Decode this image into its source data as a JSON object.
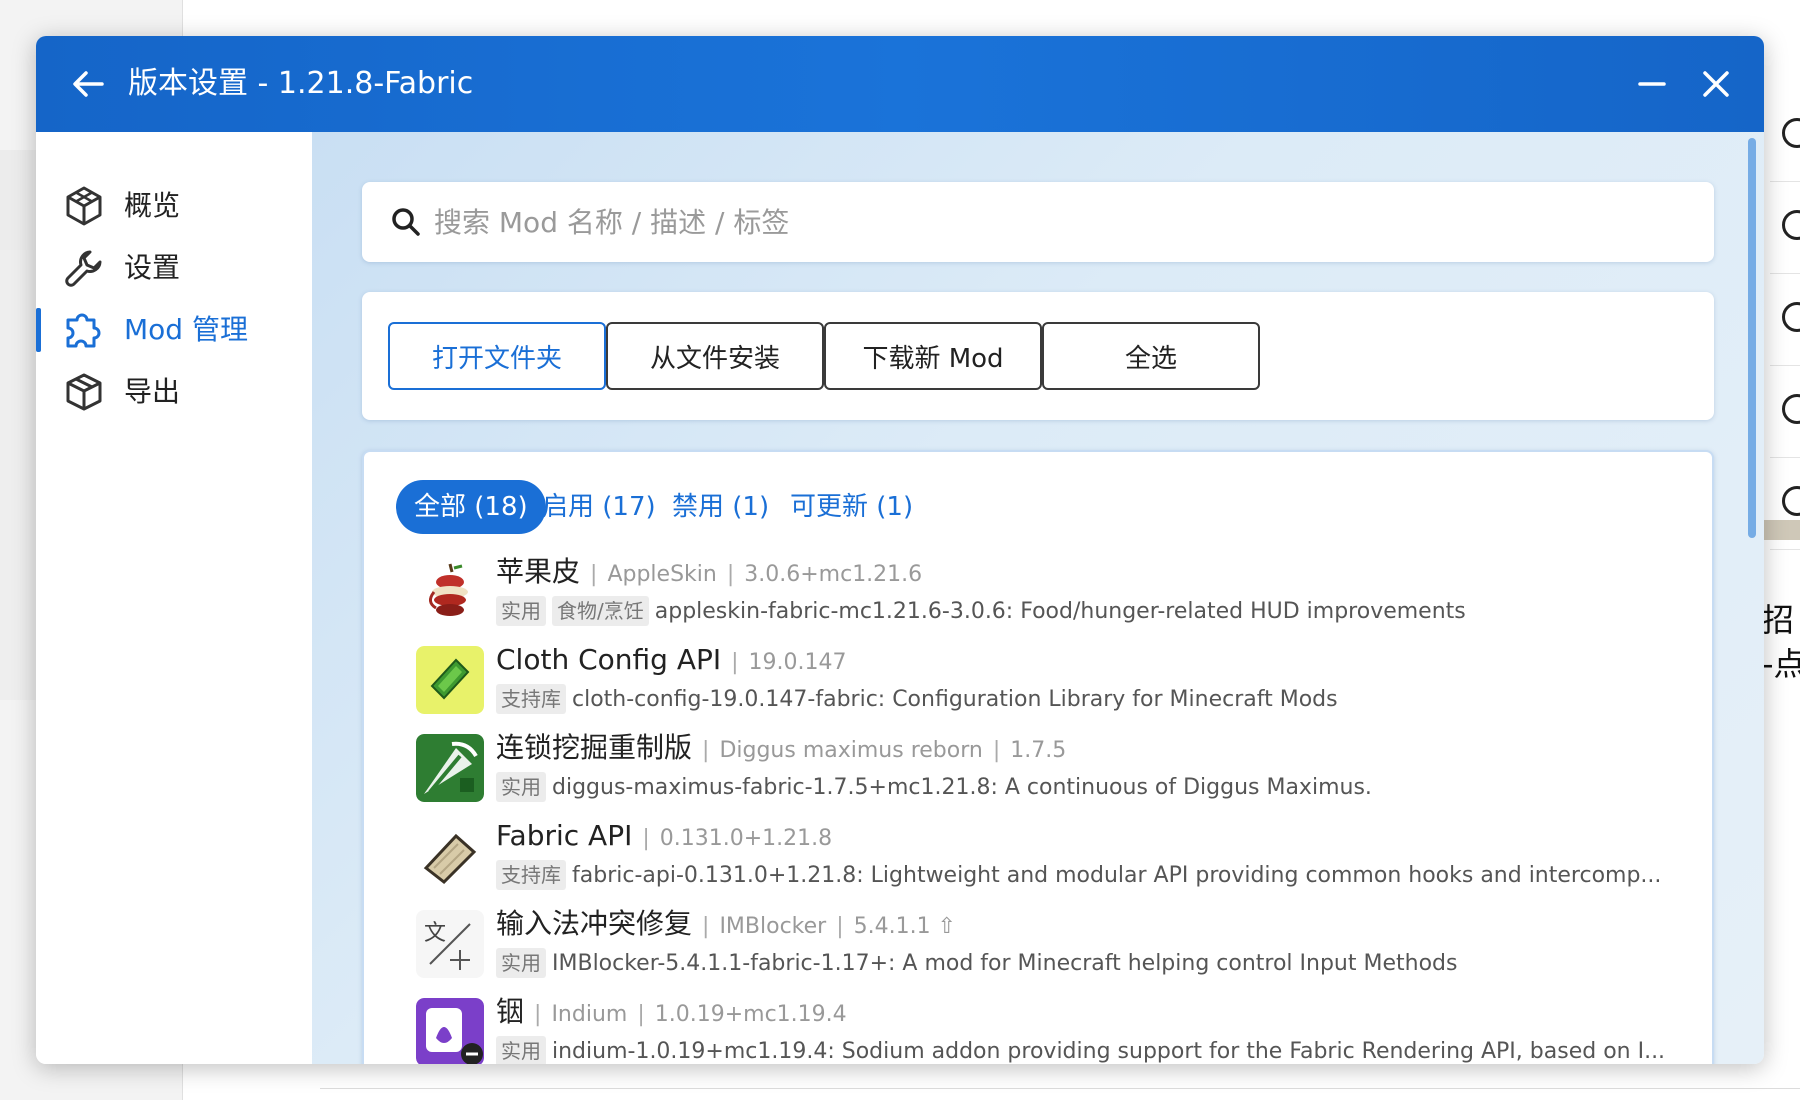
{
  "window": {
    "title": "版本设置 - 1.21.8-Fabric"
  },
  "background": {
    "side_text": "招\n-点"
  },
  "sidebar": {
    "items": [
      {
        "label": "概览",
        "icon": "overview-icon"
      },
      {
        "label": "设置",
        "icon": "wrench-icon"
      },
      {
        "label": "Mod 管理",
        "icon": "puzzle-icon"
      },
      {
        "label": "导出",
        "icon": "box-icon"
      }
    ],
    "active_index": 2
  },
  "search": {
    "placeholder": "搜索 Mod 名称 / 描述 / 标签",
    "value": ""
  },
  "actions": {
    "open_folder": "打开文件夹",
    "install_from_file": "从文件安装",
    "download_new": "下载新 Mod",
    "select_all": "全选"
  },
  "tabs": [
    {
      "label": "全部 (18)",
      "active": true
    },
    {
      "label": "启用 (17)",
      "active": false
    },
    {
      "label": "禁用 (1)",
      "active": false
    },
    {
      "label": "可更新 (1)",
      "active": false
    }
  ],
  "mods": [
    {
      "name": "苹果皮",
      "meta": [
        "AppleSkin",
        "3.0.6+mc1.21.6"
      ],
      "tags": [
        "实用",
        "食物/烹饪"
      ],
      "desc": "appleskin-fabric-mc1.21.6-3.0.6: Food/hunger-related HUD improvements",
      "icon": "apple-peel-icon"
    },
    {
      "name": "Cloth Config API",
      "meta": [
        "19.0.147"
      ],
      "tags": [
        "支持库"
      ],
      "desc": "cloth-config-19.0.147-fabric: Configuration Library for Minecraft Mods",
      "icon": "cloth-config-icon"
    },
    {
      "name": "连锁挖掘重制版",
      "meta": [
        "Diggus maximus reborn",
        "1.7.5"
      ],
      "tags": [
        "实用"
      ],
      "desc": "diggus-maximus-fabric-1.7.5+mc1.21.8: A continuous of Diggus Maximus.",
      "icon": "pickaxe-icon"
    },
    {
      "name": "Fabric API",
      "meta": [
        "0.131.0+1.21.8"
      ],
      "tags": [
        "支持库"
      ],
      "desc": "fabric-api-0.131.0+1.21.8: Lightweight and modular API providing common hooks and intercomp...",
      "icon": "fabric-scroll-icon"
    },
    {
      "name": "输入法冲突修复",
      "meta": [
        "IMBlocker",
        "5.4.1.1 ⇧"
      ],
      "tags": [
        "实用"
      ],
      "desc": "IMBlocker-5.4.1.1-fabric-1.17+: A mod for Minecraft helping control Input Methods",
      "icon": "ime-icon"
    },
    {
      "name": "铟",
      "meta": [
        "Indium",
        "1.0.19+mc1.19.4"
      ],
      "tags": [
        "实用"
      ],
      "desc": "indium-1.0.19+mc1.19.4: Sodium addon providing support for the Fabric Rendering API, based on I...",
      "icon": "indium-icon"
    }
  ]
}
